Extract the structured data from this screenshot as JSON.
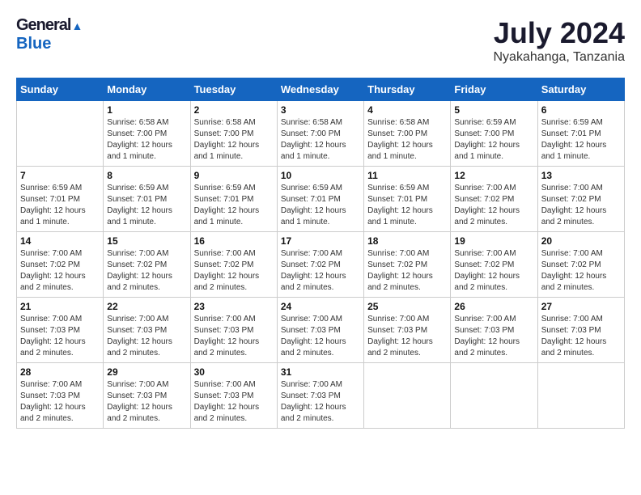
{
  "header": {
    "logo_general": "General",
    "logo_blue": "Blue",
    "month_title": "July 2024",
    "location": "Nyakahanga, Tanzania"
  },
  "weekdays": [
    "Sunday",
    "Monday",
    "Tuesday",
    "Wednesday",
    "Thursday",
    "Friday",
    "Saturday"
  ],
  "weeks": [
    [
      {
        "num": "",
        "info": ""
      },
      {
        "num": "1",
        "info": "Sunrise: 6:58 AM\nSunset: 7:00 PM\nDaylight: 12 hours\nand 1 minute."
      },
      {
        "num": "2",
        "info": "Sunrise: 6:58 AM\nSunset: 7:00 PM\nDaylight: 12 hours\nand 1 minute."
      },
      {
        "num": "3",
        "info": "Sunrise: 6:58 AM\nSunset: 7:00 PM\nDaylight: 12 hours\nand 1 minute."
      },
      {
        "num": "4",
        "info": "Sunrise: 6:58 AM\nSunset: 7:00 PM\nDaylight: 12 hours\nand 1 minute."
      },
      {
        "num": "5",
        "info": "Sunrise: 6:59 AM\nSunset: 7:00 PM\nDaylight: 12 hours\nand 1 minute."
      },
      {
        "num": "6",
        "info": "Sunrise: 6:59 AM\nSunset: 7:01 PM\nDaylight: 12 hours\nand 1 minute."
      }
    ],
    [
      {
        "num": "7",
        "info": "Sunrise: 6:59 AM\nSunset: 7:01 PM\nDaylight: 12 hours\nand 1 minute."
      },
      {
        "num": "8",
        "info": "Sunrise: 6:59 AM\nSunset: 7:01 PM\nDaylight: 12 hours\nand 1 minute."
      },
      {
        "num": "9",
        "info": "Sunrise: 6:59 AM\nSunset: 7:01 PM\nDaylight: 12 hours\nand 1 minute."
      },
      {
        "num": "10",
        "info": "Sunrise: 6:59 AM\nSunset: 7:01 PM\nDaylight: 12 hours\nand 1 minute."
      },
      {
        "num": "11",
        "info": "Sunrise: 6:59 AM\nSunset: 7:01 PM\nDaylight: 12 hours\nand 1 minute."
      },
      {
        "num": "12",
        "info": "Sunrise: 7:00 AM\nSunset: 7:02 PM\nDaylight: 12 hours\nand 2 minutes."
      },
      {
        "num": "13",
        "info": "Sunrise: 7:00 AM\nSunset: 7:02 PM\nDaylight: 12 hours\nand 2 minutes."
      }
    ],
    [
      {
        "num": "14",
        "info": "Sunrise: 7:00 AM\nSunset: 7:02 PM\nDaylight: 12 hours\nand 2 minutes."
      },
      {
        "num": "15",
        "info": "Sunrise: 7:00 AM\nSunset: 7:02 PM\nDaylight: 12 hours\nand 2 minutes."
      },
      {
        "num": "16",
        "info": "Sunrise: 7:00 AM\nSunset: 7:02 PM\nDaylight: 12 hours\nand 2 minutes."
      },
      {
        "num": "17",
        "info": "Sunrise: 7:00 AM\nSunset: 7:02 PM\nDaylight: 12 hours\nand 2 minutes."
      },
      {
        "num": "18",
        "info": "Sunrise: 7:00 AM\nSunset: 7:02 PM\nDaylight: 12 hours\nand 2 minutes."
      },
      {
        "num": "19",
        "info": "Sunrise: 7:00 AM\nSunset: 7:02 PM\nDaylight: 12 hours\nand 2 minutes."
      },
      {
        "num": "20",
        "info": "Sunrise: 7:00 AM\nSunset: 7:02 PM\nDaylight: 12 hours\nand 2 minutes."
      }
    ],
    [
      {
        "num": "21",
        "info": "Sunrise: 7:00 AM\nSunset: 7:03 PM\nDaylight: 12 hours\nand 2 minutes."
      },
      {
        "num": "22",
        "info": "Sunrise: 7:00 AM\nSunset: 7:03 PM\nDaylight: 12 hours\nand 2 minutes."
      },
      {
        "num": "23",
        "info": "Sunrise: 7:00 AM\nSunset: 7:03 PM\nDaylight: 12 hours\nand 2 minutes."
      },
      {
        "num": "24",
        "info": "Sunrise: 7:00 AM\nSunset: 7:03 PM\nDaylight: 12 hours\nand 2 minutes."
      },
      {
        "num": "25",
        "info": "Sunrise: 7:00 AM\nSunset: 7:03 PM\nDaylight: 12 hours\nand 2 minutes."
      },
      {
        "num": "26",
        "info": "Sunrise: 7:00 AM\nSunset: 7:03 PM\nDaylight: 12 hours\nand 2 minutes."
      },
      {
        "num": "27",
        "info": "Sunrise: 7:00 AM\nSunset: 7:03 PM\nDaylight: 12 hours\nand 2 minutes."
      }
    ],
    [
      {
        "num": "28",
        "info": "Sunrise: 7:00 AM\nSunset: 7:03 PM\nDaylight: 12 hours\nand 2 minutes."
      },
      {
        "num": "29",
        "info": "Sunrise: 7:00 AM\nSunset: 7:03 PM\nDaylight: 12 hours\nand 2 minutes."
      },
      {
        "num": "30",
        "info": "Sunrise: 7:00 AM\nSunset: 7:03 PM\nDaylight: 12 hours\nand 2 minutes."
      },
      {
        "num": "31",
        "info": "Sunrise: 7:00 AM\nSunset: 7:03 PM\nDaylight: 12 hours\nand 2 minutes."
      },
      {
        "num": "",
        "info": ""
      },
      {
        "num": "",
        "info": ""
      },
      {
        "num": "",
        "info": ""
      }
    ]
  ]
}
